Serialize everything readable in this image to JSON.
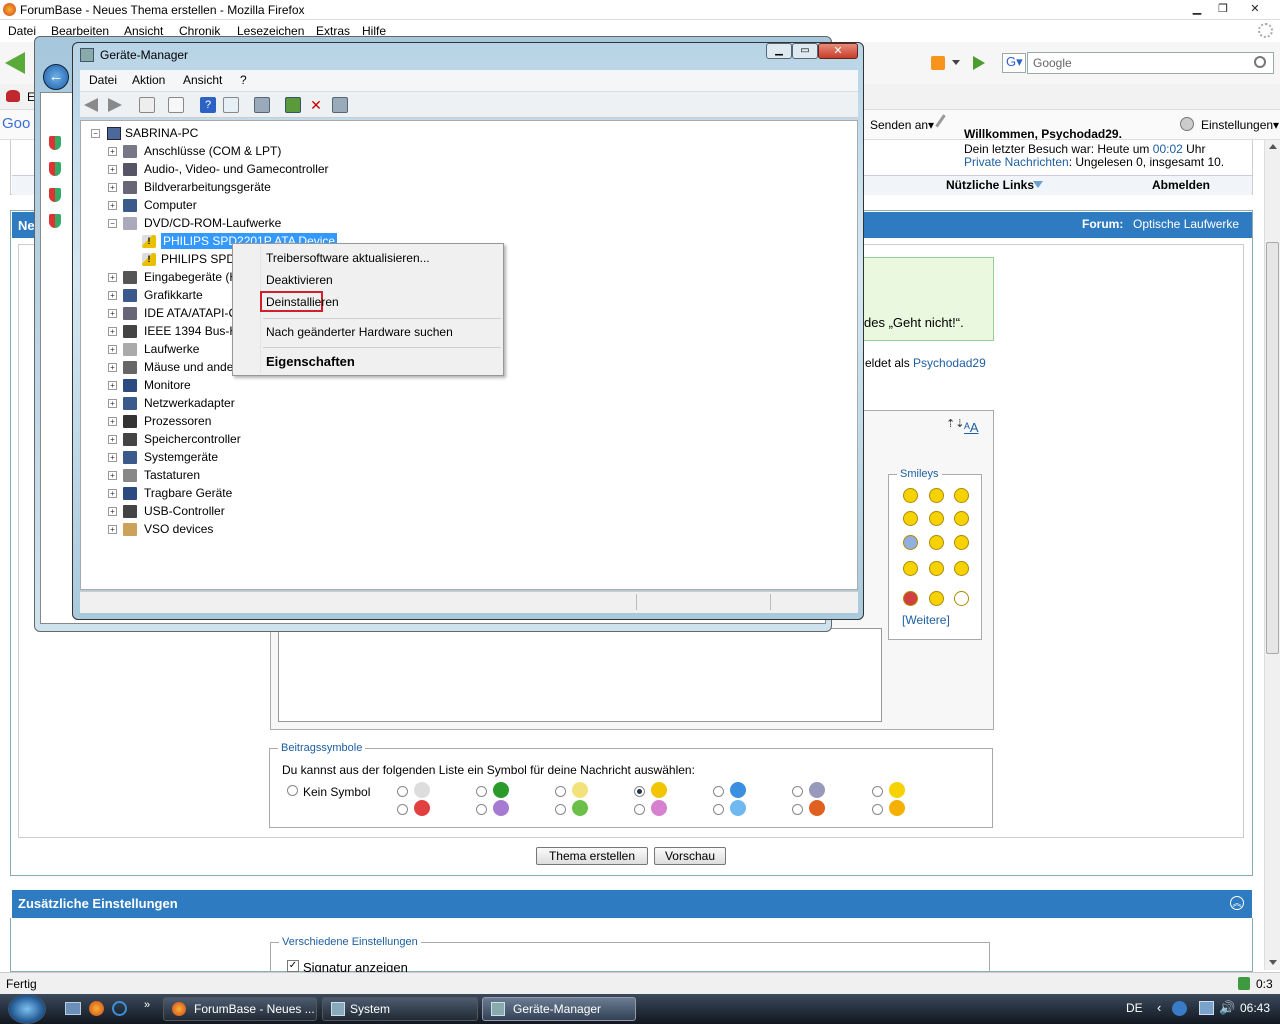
{
  "firefox": {
    "window_title": "ForumBase - Neues Thema erstellen - Mozilla Firefox",
    "menu": [
      "Datei",
      "Bearbeiten",
      "Ansicht",
      "Chronik",
      "Lesezeichen",
      "Extras",
      "Hilfe"
    ],
    "search_placeholder": "Google",
    "google_bar": {
      "senden": "Senden an▾",
      "einstellungen": "Einstellungen▾",
      "logo_text": "Goo"
    },
    "bookmark_initial": "E",
    "status": "Fertig",
    "status_right": "0:3"
  },
  "forum": {
    "welcome_partial": "Willkommen, Psychodad29.",
    "last_visit_prefix": "Dein letzter Besuch war: Heute um",
    "last_visit_time": "00:02",
    "last_visit_suffix": "Uhr",
    "pm_link": "Private Nachrichten",
    "pm_status": ": Ungelesen 0, insgesamt 10.",
    "useful_links": "Nützliche Links",
    "logout": "Abmelden",
    "bar_left_partial": "Ne",
    "forum_label": "Forum:",
    "forum_name": "Optische Laufwerke",
    "notice_partial": "des „Geht nicht!“.",
    "logged_in_prefix": "eldet als",
    "logged_in_user": "Psychodad29",
    "smileys_title": "Smileys",
    "smileys_more": "[Weitere]",
    "symbols_legend": "Beitragssymbole",
    "symbols_desc": "Du kannst aus der folgenden Liste ein Symbol für deine Nachricht auswählen:",
    "no_symbol": "Kein Symbol",
    "btn_create": "Thema erstellen",
    "btn_preview": "Vorschau",
    "extra_settings": "Zusätzliche Einstellungen",
    "misc_legend": "Verschiedene Einstellungen",
    "signature_label": "Signatur anzeigen"
  },
  "device_manager": {
    "title": "Geräte-Manager",
    "menu": [
      "Datei",
      "Aktion",
      "Ansicht",
      "?"
    ],
    "root": "SABRINA-PC",
    "tree": [
      {
        "label": "Anschlüsse (COM & LPT)",
        "icon": "port-icon"
      },
      {
        "label": "Audio-, Video- und Gamecontroller",
        "icon": "speaker-icon"
      },
      {
        "label": "Bildverarbeitungsgeräte",
        "icon": "camera-icon"
      },
      {
        "label": "Computer",
        "icon": "computer-icon"
      },
      {
        "label": "DVD/CD-ROM-Laufwerke",
        "icon": "dvd-drive-icon",
        "expanded": true
      },
      {
        "label": "PHILIPS SPD2201P ATA Device",
        "icon": "warning-drive-icon",
        "child": true,
        "selected": true
      },
      {
        "label": "PHILIPS SPD6",
        "icon": "warning-drive-icon",
        "child": true
      },
      {
        "label": "Eingabegeräte (H",
        "icon": "input-device-icon"
      },
      {
        "label": "Grafikkarte",
        "icon": "display-adapter-icon"
      },
      {
        "label": "IDE ATA/ATAPI-C",
        "icon": "ide-icon"
      },
      {
        "label": "IEEE 1394 Bus-Ho",
        "icon": "firewire-icon"
      },
      {
        "label": "Laufwerke",
        "icon": "disk-icon"
      },
      {
        "label": "Mäuse und ande",
        "icon": "mouse-icon"
      },
      {
        "label": "Monitore",
        "icon": "monitor-icon"
      },
      {
        "label": "Netzwerkadapter",
        "icon": "network-icon"
      },
      {
        "label": "Prozessoren",
        "icon": "cpu-icon"
      },
      {
        "label": "Speichercontroller",
        "icon": "storage-controller-icon"
      },
      {
        "label": "Systemgeräte",
        "icon": "system-device-icon"
      },
      {
        "label": "Tastaturen",
        "icon": "keyboard-icon"
      },
      {
        "label": "Tragbare Geräte",
        "icon": "portable-device-icon"
      },
      {
        "label": "USB-Controller",
        "icon": "usb-icon"
      },
      {
        "label": "VSO devices",
        "icon": "vso-icon"
      }
    ],
    "context_menu": {
      "update": "Treibersoftware aktualisieren...",
      "disable": "Deaktivieren",
      "uninstall": "Deinstallieren",
      "scan": "Nach geänderter Hardware suchen",
      "properties": "Eigenschaften"
    }
  },
  "taskbar": {
    "items": [
      "ForumBase - Neues ...",
      "System",
      "Geräte-Manager"
    ],
    "lang": "DE",
    "clock": "06:43"
  },
  "colors": {
    "accent_blue": "#2f7bc2",
    "highlight": "#3399ff",
    "callout_red": "#d0202a"
  }
}
